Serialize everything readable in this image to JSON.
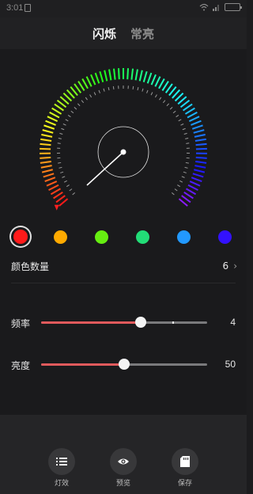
{
  "status_bar": {
    "time": "3:01"
  },
  "header": {
    "tabs": [
      {
        "label": "闪烁",
        "active": true
      },
      {
        "label": "常亮",
        "active": false
      }
    ]
  },
  "colors": {
    "swatches": [
      "#ff1a1a",
      "#ffaa00",
      "#66ee11",
      "#22dd77",
      "#2299ff",
      "#3311ff"
    ],
    "selected_index": 0
  },
  "color_count": {
    "label": "颜色数量",
    "value": "6"
  },
  "sliders": [
    {
      "label": "频率",
      "value": "4",
      "fraction": 0.6
    },
    {
      "label": "亮度",
      "value": "50",
      "fraction": 0.5
    }
  ],
  "actions": [
    {
      "label": "灯效",
      "icon": "list-icon"
    },
    {
      "label": "预览",
      "icon": "eye-icon"
    },
    {
      "label": "保存",
      "icon": "sd-card-icon"
    }
  ]
}
